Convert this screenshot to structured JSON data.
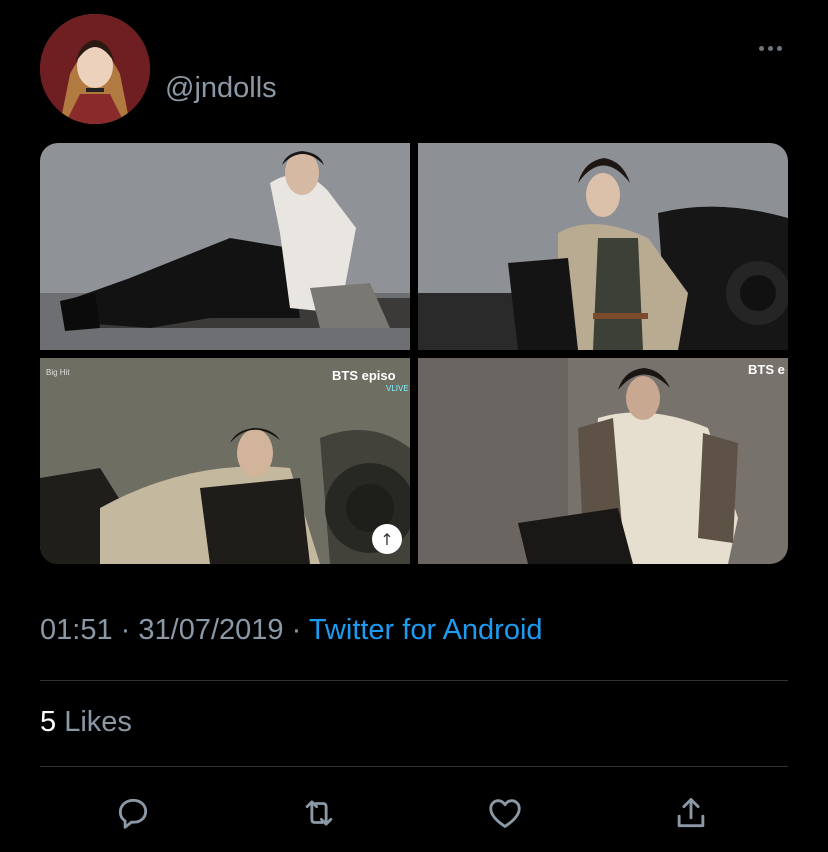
{
  "tweet": {
    "handle": "@jndolls",
    "time": "01:51",
    "date": "31/07/2019",
    "separator": "·",
    "source": "Twitter for Android",
    "likes_count": "5",
    "likes_label": "Likes"
  },
  "media": {
    "overlays": {
      "bighit": "Big Hit",
      "bts_episode_1": "BTS episo",
      "vlive": "VLIVE",
      "bts_episode_2": "BTS e"
    },
    "up_arrow": "↑"
  },
  "icons": {
    "more": "more-icon",
    "reply": "reply-icon",
    "retweet": "retweet-icon",
    "like": "like-icon",
    "share": "share-icon"
  },
  "colors": {
    "background": "#000000",
    "secondary_text": "#8b98a5",
    "link": "#1d9bf0",
    "divider": "#2f3336",
    "icon": "#8b98a5"
  }
}
